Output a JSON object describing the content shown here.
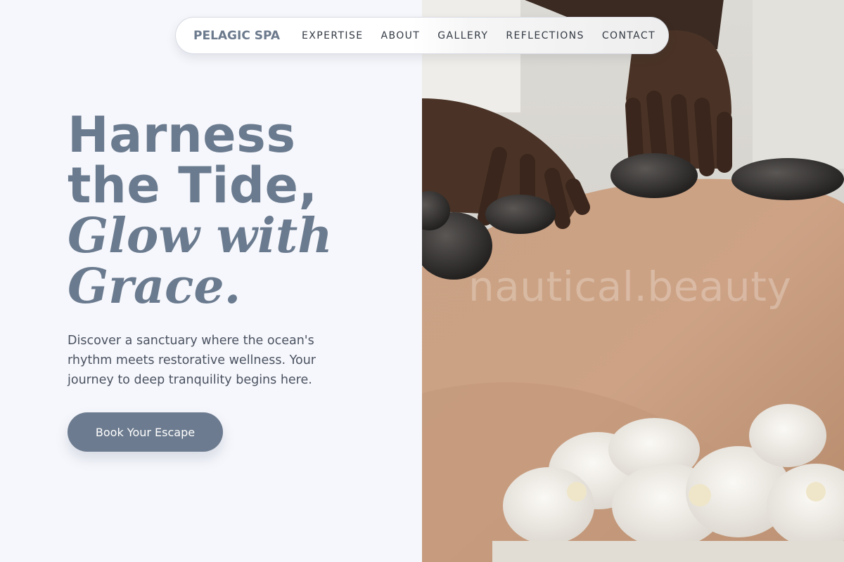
{
  "brand": {
    "name": "PELAGIC SPA"
  },
  "nav": {
    "items": [
      {
        "label": "EXPERTISE"
      },
      {
        "label": "ABOUT"
      },
      {
        "label": "GALLERY"
      },
      {
        "label": "REFLECTIONS"
      },
      {
        "label": "CONTACT"
      }
    ]
  },
  "hero": {
    "title_line1": "Harness",
    "title_line2": "the Tide,",
    "title_italic1": "Glow with",
    "title_italic2": "Grace.",
    "intro": "Discover a sanctuary where the ocean's rhythm meets restorative wellness. Your journey to deep tranquility begins here.",
    "cta_label": "Book Your Escape"
  },
  "photo": {
    "subject": "hot stone massage with white orchids",
    "watermark": "nautical.beauty"
  },
  "colors": {
    "accent": "#6c7b8f",
    "background": "#f6f7fc",
    "body_text": "#4a5260",
    "nav_text": "#333a44"
  }
}
